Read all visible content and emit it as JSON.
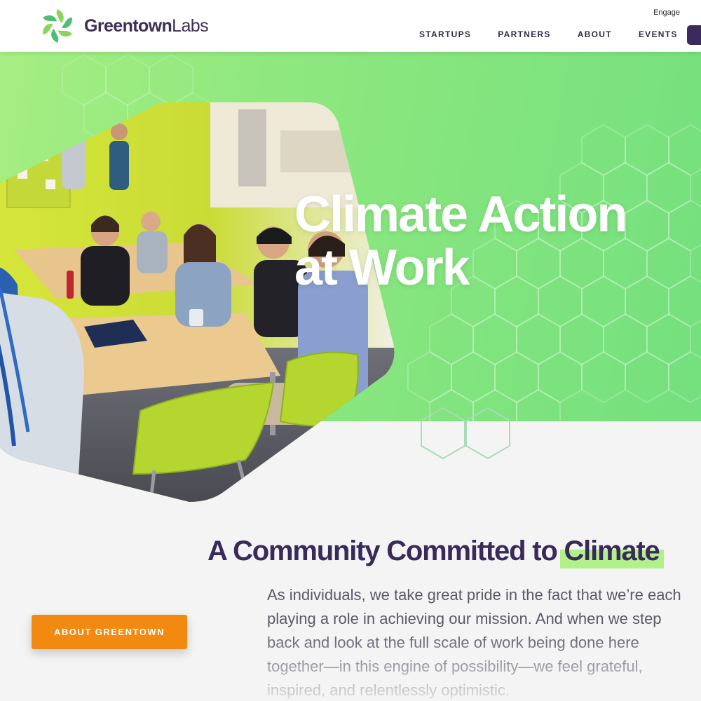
{
  "brand": {
    "name_bold": "Greentown",
    "name_light": "Labs",
    "logo_icon": "greentown-leaf-logo-icon",
    "colors": {
      "navy": "#3b2a5c",
      "green": "#8fe87e",
      "leaf_green": "#8ed45b",
      "orange": "#f28a12"
    }
  },
  "header": {
    "engage": "Engage",
    "nav": [
      "STARTUPS",
      "PARTNERS",
      "ABOUT",
      "EVENTS"
    ]
  },
  "hero": {
    "title_line1": "Climate Action",
    "title_line2": "at Work",
    "photo_alt": "people-meeting-at-tables-photo"
  },
  "community": {
    "heading_prefix": "A Community Committed to ",
    "heading_highlight": "Climate",
    "body": "As individuals, we take great pride in the fact that we’re each playing a role in achieving our mission. And when we step back and look at the full scale of work being done here together—in this engine of possibility—we feel grateful, inspired, and relentlessly optimistic.",
    "button": "ABOUT GREENTOWN"
  }
}
